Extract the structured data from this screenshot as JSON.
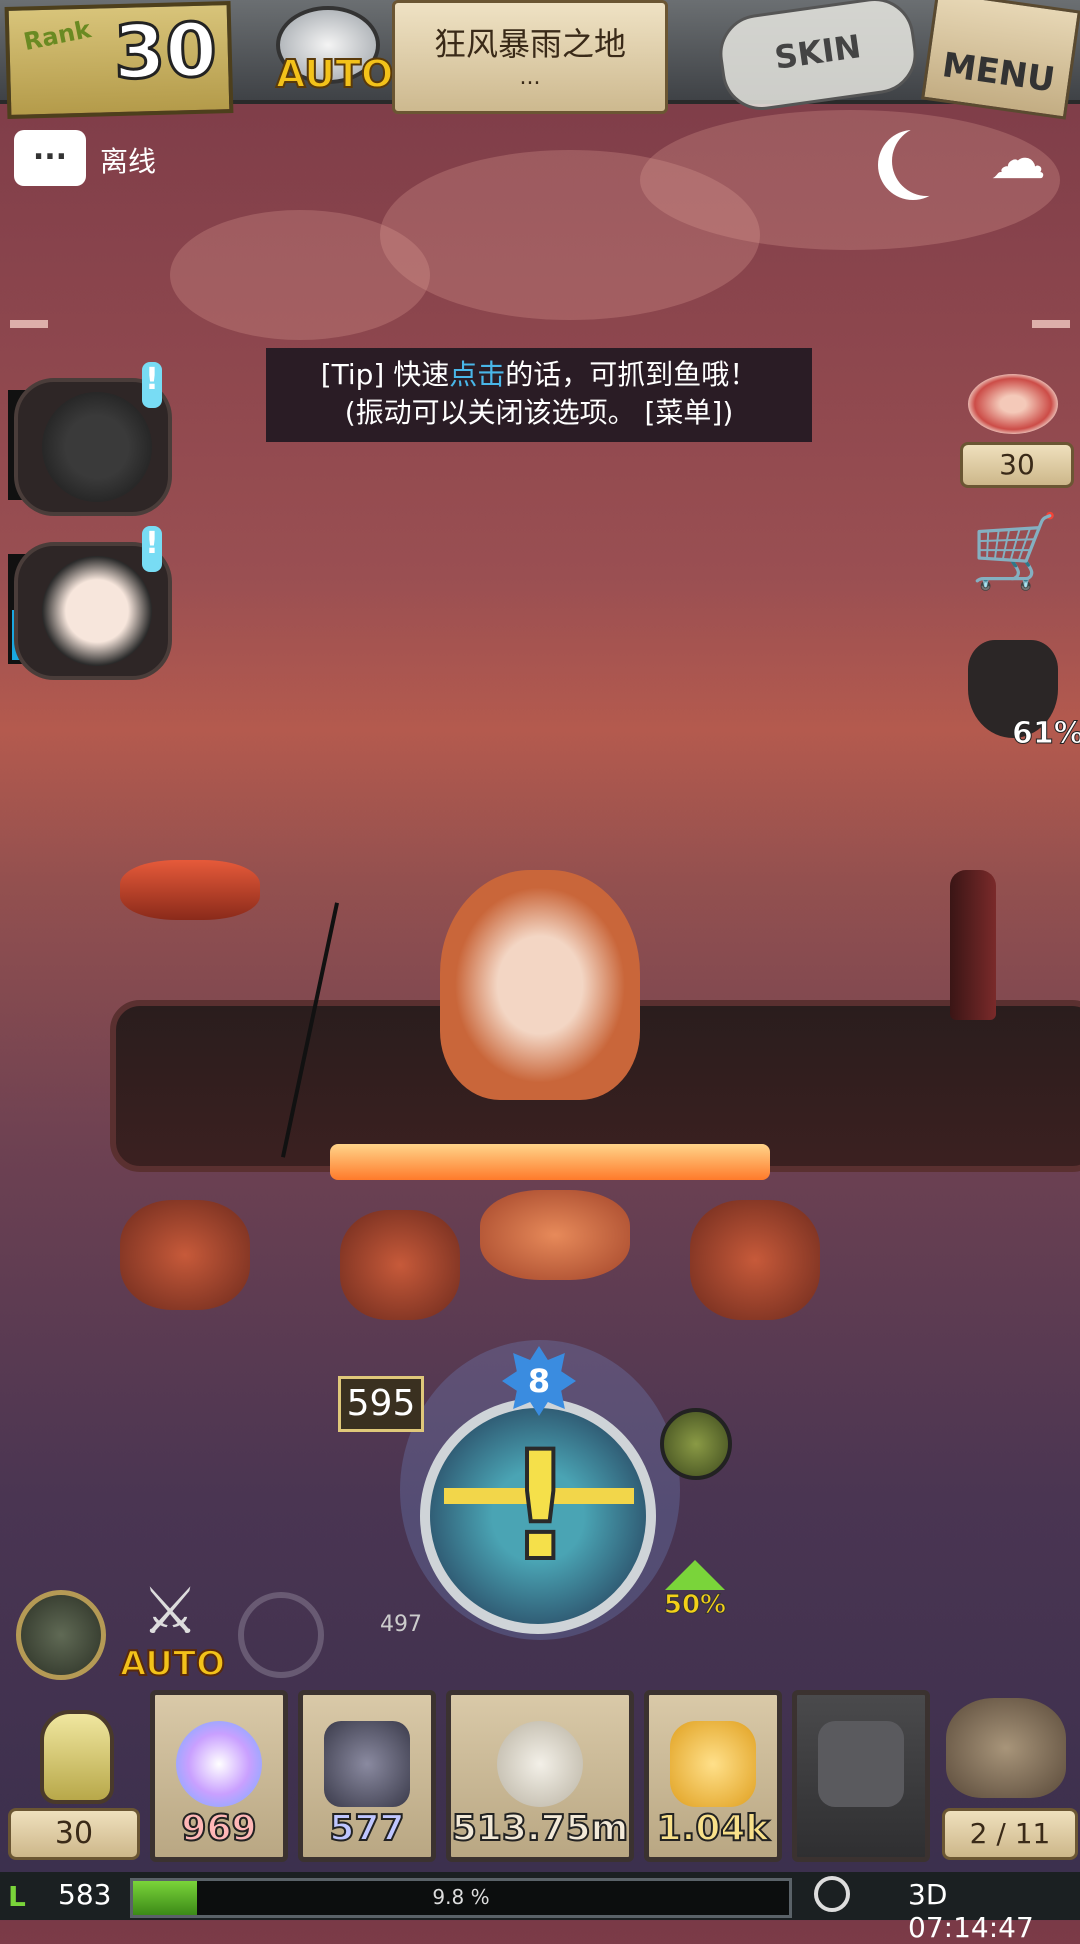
{
  "rank": {
    "label": "Rank",
    "value": "30"
  },
  "auto_top": {
    "label": "AUTO"
  },
  "location": {
    "name": "狂风暴雨之地",
    "sub": "..."
  },
  "skin_label": "SKIN",
  "menu_label": "MENU",
  "status": {
    "chat_glyph": "...",
    "offline_label": "离线"
  },
  "tip": {
    "line1_a": "[Tip] 快速",
    "line1_hl": "点击",
    "line1_b": "的话，可抓到鱼哦！",
    "line2": "(振动可以关闭该选项。 [菜单])",
    "highlight_color": "#49b6e8"
  },
  "portraits": [
    {
      "name": "hooded-character",
      "excl": "!"
    },
    {
      "name": "girl-character",
      "excl": "!"
    }
  ],
  "right_panel": {
    "meat_count": "30",
    "mask_percent": "61%",
    "cart_glyph": "🛒",
    "cloud_glyph": "☁"
  },
  "fishing": {
    "distance": "595",
    "level_badge": "8",
    "depth_marker": "497",
    "boost_percent": "50%",
    "gauge_glyph": "!"
  },
  "controls": {
    "auto_label": "AUTO",
    "sword_glyph": "⚔"
  },
  "lamp": {
    "count": "30"
  },
  "inventory": [
    {
      "name": "rainbow-pearl",
      "value": "969",
      "color": "#ffb7b7"
    },
    {
      "name": "skull-shield",
      "value": "577",
      "color": "#bfc6ff"
    },
    {
      "name": "shell",
      "value": "513.75m",
      "color": "#f2e9d8"
    },
    {
      "name": "amber",
      "value": "1.04k",
      "color": "#f8e08a"
    },
    {
      "name": "locked",
      "value": ""
    }
  ],
  "bag": {
    "capacity": "2 / 11"
  },
  "bottom_bar": {
    "level": "583",
    "xp_percent_text": "9.8 %",
    "xp_fraction": 0.098,
    "timer": "3D 07:14:47"
  }
}
